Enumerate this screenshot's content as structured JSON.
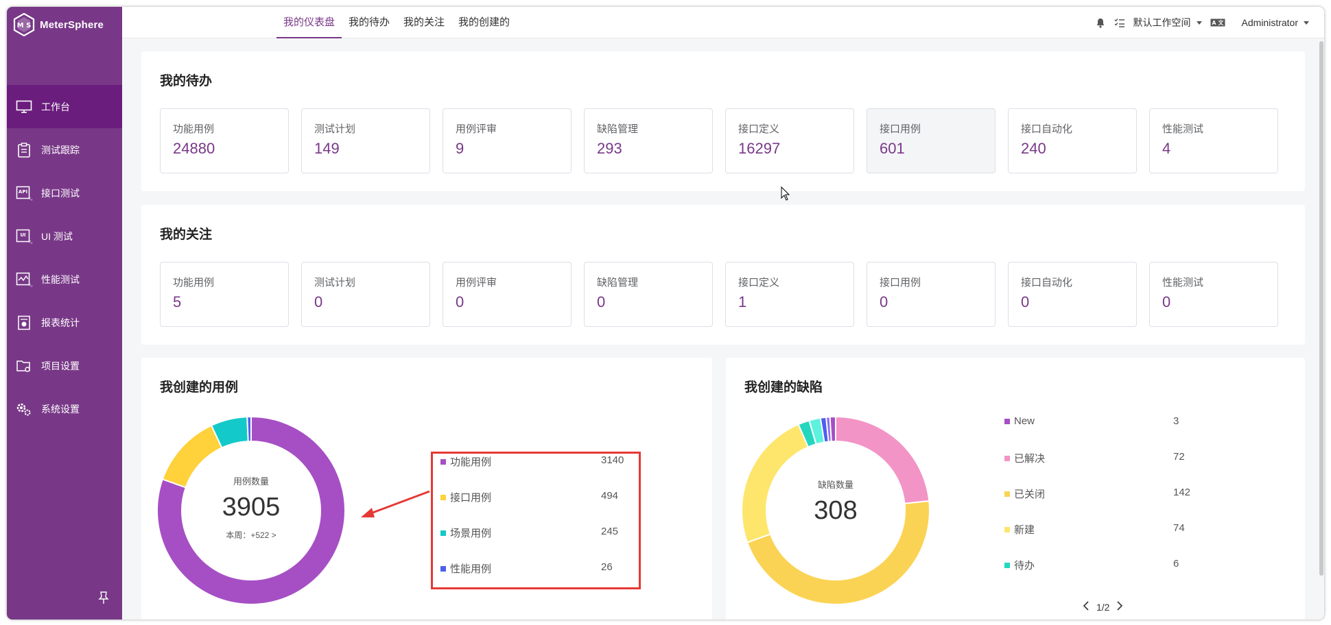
{
  "app": {
    "name": "MeterSphere"
  },
  "colors": {
    "brand": "#783887",
    "brand_dark": "#6a1d7d"
  },
  "sidebar": {
    "items": [
      {
        "label": "工作台",
        "icon": "monitor-icon",
        "active": true
      },
      {
        "label": "测试跟踪",
        "icon": "clipboard-icon",
        "active": false
      },
      {
        "label": "接口测试",
        "icon": "api-icon",
        "active": false
      },
      {
        "label": "UI 测试",
        "icon": "ui-icon",
        "active": false
      },
      {
        "label": "性能测试",
        "icon": "performance-icon",
        "active": false
      },
      {
        "label": "报表统计",
        "icon": "report-icon",
        "active": false
      },
      {
        "label": "项目设置",
        "icon": "folder-settings-icon",
        "active": false
      },
      {
        "label": "系统设置",
        "icon": "gears-icon",
        "active": false
      }
    ]
  },
  "header": {
    "tabs": [
      {
        "label": "我的仪表盘",
        "active": true
      },
      {
        "label": "我的待办",
        "active": false
      },
      {
        "label": "我的关注",
        "active": false
      },
      {
        "label": "我的创建的",
        "active": false
      }
    ],
    "workspace": "默认工作空间",
    "user": "Administrator"
  },
  "todo": {
    "title": "我的待办",
    "cards": [
      {
        "label": "功能用例",
        "value": "24880"
      },
      {
        "label": "测试计划",
        "value": "149"
      },
      {
        "label": "用例评审",
        "value": "9"
      },
      {
        "label": "缺陷管理",
        "value": "293"
      },
      {
        "label": "接口定义",
        "value": "16297"
      },
      {
        "label": "接口用例",
        "value": "601"
      },
      {
        "label": "接口自动化",
        "value": "240"
      },
      {
        "label": "性能测试",
        "value": "4"
      }
    ]
  },
  "follow": {
    "title": "我的关注",
    "cards": [
      {
        "label": "功能用例",
        "value": "5"
      },
      {
        "label": "测试计划",
        "value": "0"
      },
      {
        "label": "用例评审",
        "value": "0"
      },
      {
        "label": "缺陷管理",
        "value": "0"
      },
      {
        "label": "接口定义",
        "value": "1"
      },
      {
        "label": "接口用例",
        "value": "0"
      },
      {
        "label": "接口自动化",
        "value": "0"
      },
      {
        "label": "性能测试",
        "value": "0"
      }
    ]
  },
  "cases": {
    "title": "我创建的用例",
    "center_label": "用例数量",
    "total": "3905",
    "weekly": "本周：+522 >",
    "legend": [
      {
        "name": "功能用例",
        "value": "3140",
        "color": "#a64fc4"
      },
      {
        "name": "接口用例",
        "value": "494",
        "color": "#ffd13a"
      },
      {
        "name": "场景用例",
        "value": "245",
        "color": "#14c9c9"
      },
      {
        "name": "性能用例",
        "value": "26",
        "color": "#4e5ef1"
      }
    ]
  },
  "defects": {
    "title": "我创建的缺陷",
    "center_label": "缺陷数量",
    "total": "308",
    "legend": [
      {
        "name": "New",
        "value": "3",
        "color": "#a64fc4"
      },
      {
        "name": "已解决",
        "value": "72",
        "color": "#f294c6"
      },
      {
        "name": "已关闭",
        "value": "142",
        "color": "#fbd354"
      },
      {
        "name": "新建",
        "value": "74",
        "color": "#fde66b"
      },
      {
        "name": "待办",
        "value": "6",
        "color": "#23d7bf"
      }
    ],
    "hidden_slices": [
      {
        "value": 6,
        "color": "#5cf2de"
      },
      {
        "value": 3,
        "color": "#4e5ef1"
      },
      {
        "value": 2,
        "color": "#8c6cf1"
      }
    ],
    "page": "1/2"
  }
}
